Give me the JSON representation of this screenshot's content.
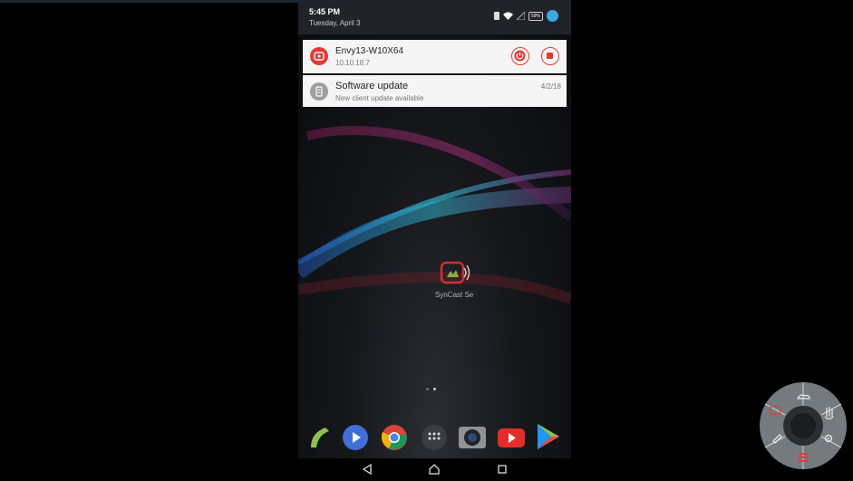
{
  "status_bar": {
    "time": "5:45 PM",
    "date": "Tuesday, April 3",
    "battery": "59%",
    "icons": [
      "sim-icon",
      "wifi-icon",
      "signal-icon",
      "battery-icon",
      "account-icon"
    ]
  },
  "notifications": [
    {
      "title": "Envy13-W10X64",
      "subtitle": "10.10.18.7",
      "icon": "syncast-icon",
      "actions": [
        "power-icon",
        "stop-icon"
      ]
    },
    {
      "title": "Software update",
      "subtitle": "New client update available",
      "time": "4/2/18",
      "icon": "update-icon"
    }
  ],
  "home": {
    "app_label": "SynCast Se",
    "page_indicator": {
      "pages": 2,
      "current": 2
    },
    "dock": [
      "phone-icon",
      "play-music-icon",
      "chrome-icon",
      "app-drawer-icon",
      "camera-icon",
      "youtube-icon",
      "play-store-icon"
    ]
  },
  "nav": [
    "back-icon",
    "home-icon",
    "recents-icon"
  ],
  "colors": {
    "accent": "#e53935",
    "status_bar": "#202327",
    "notification_bg": "#f5f5f5"
  }
}
